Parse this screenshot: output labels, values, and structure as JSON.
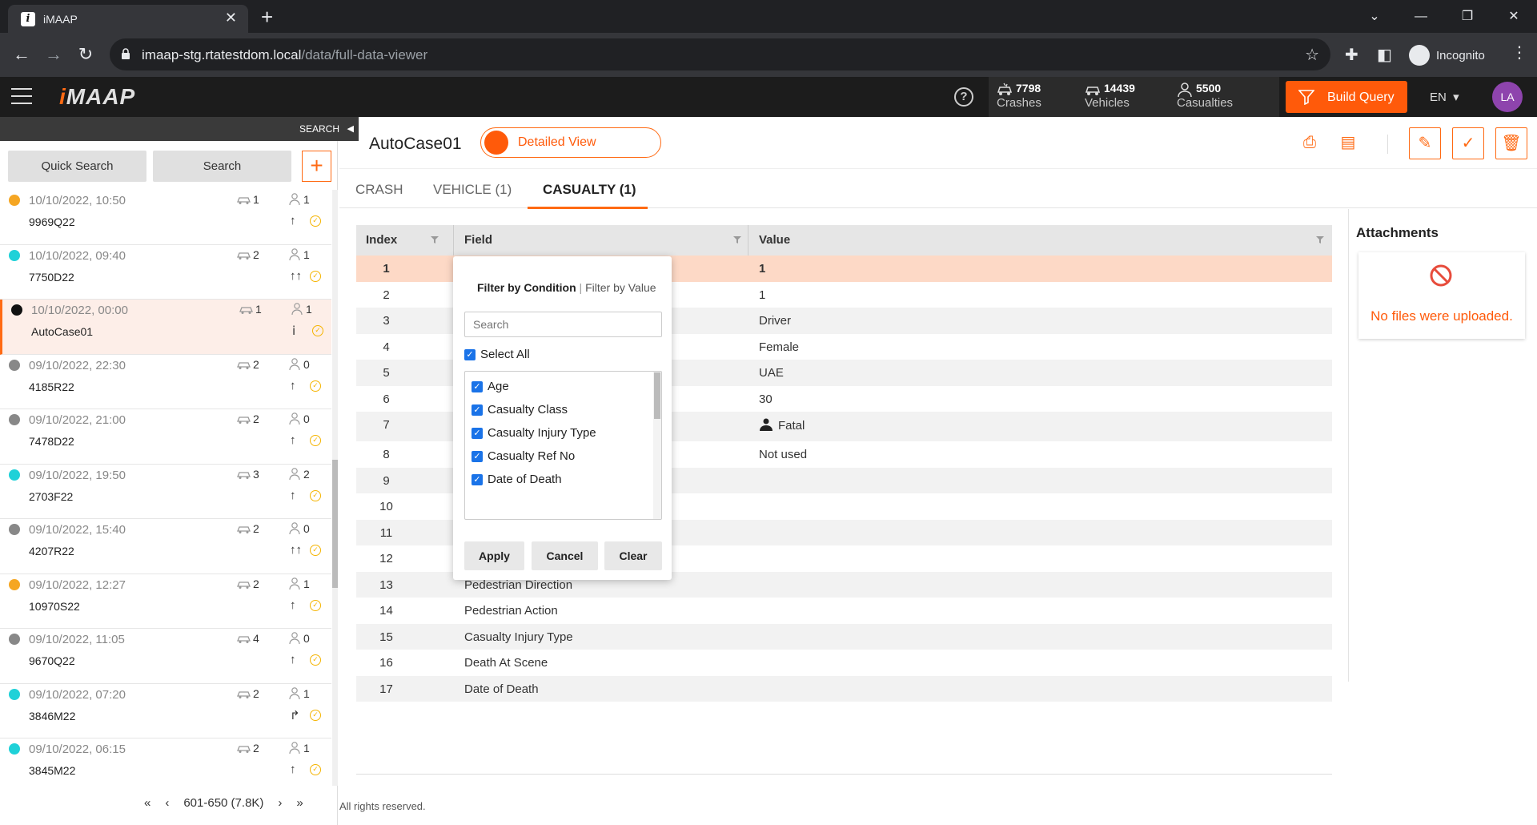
{
  "browser": {
    "tab_title": "iMAAP",
    "url_host": "imaap-stg.rtatestdom.local",
    "url_path": "/data/full-data-viewer",
    "profile": "Incognito"
  },
  "app": {
    "logo_prefix": "i",
    "logo_rest": "MAAP",
    "stats": {
      "crashes": {
        "value": "7798",
        "label": "Crashes"
      },
      "vehicles": {
        "value": "14439",
        "label": "Vehicles"
      },
      "casualties": {
        "value": "5500",
        "label": "Casualties"
      }
    },
    "build_query": "Build Query",
    "language": "EN",
    "avatar": "LA",
    "accent_color": "#ff5a0a"
  },
  "sidebar": {
    "strip_label": "SEARCH",
    "quick_search": "Quick Search",
    "search": "Search",
    "plus": "+",
    "cases": [
      {
        "datetime": "10/10/2022, 10:50",
        "ref": "9969Q22",
        "vehicles": "1",
        "casualties": "1",
        "dot": "#f5a623",
        "move": "↑"
      },
      {
        "datetime": "10/10/2022, 09:40",
        "ref": "7750D22",
        "vehicles": "2",
        "casualties": "1",
        "dot": "#1fd1d8",
        "move": "↑↑"
      },
      {
        "datetime": "10/10/2022, 00:00",
        "ref": "AutoCase01",
        "vehicles": "1",
        "casualties": "1",
        "dot": "#111111",
        "move": "ⅰ"
      },
      {
        "datetime": "09/10/2022, 22:30",
        "ref": "4185R22",
        "vehicles": "2",
        "casualties": "0",
        "dot": "#888888",
        "move": "↑"
      },
      {
        "datetime": "09/10/2022, 21:00",
        "ref": "7478D22",
        "vehicles": "2",
        "casualties": "0",
        "dot": "#888888",
        "move": "↑"
      },
      {
        "datetime": "09/10/2022, 19:50",
        "ref": "2703F22",
        "vehicles": "3",
        "casualties": "2",
        "dot": "#1fd1d8",
        "move": "↑"
      },
      {
        "datetime": "09/10/2022, 15:40",
        "ref": "4207R22",
        "vehicles": "2",
        "casualties": "0",
        "dot": "#888888",
        "move": "↑↑"
      },
      {
        "datetime": "09/10/2022, 12:27",
        "ref": "10970S22",
        "vehicles": "2",
        "casualties": "1",
        "dot": "#f5a623",
        "move": "↑"
      },
      {
        "datetime": "09/10/2022, 11:05",
        "ref": "9670Q22",
        "vehicles": "4",
        "casualties": "0",
        "dot": "#888888",
        "move": "↑"
      },
      {
        "datetime": "09/10/2022, 07:20",
        "ref": "3846M22",
        "vehicles": "2",
        "casualties": "1",
        "dot": "#1fd1d8",
        "move": "↱"
      },
      {
        "datetime": "09/10/2022, 06:15",
        "ref": "3845M22",
        "vehicles": "2",
        "casualties": "1",
        "dot": "#1fd1d8",
        "move": "↑"
      }
    ],
    "pager": "601-650 (7.8K)"
  },
  "main": {
    "case_title": "AutoCase01",
    "view_toggle": "Detailed View",
    "tabs": [
      "CRASH",
      "VEHICLE (1)",
      "CASUALTY (1)"
    ],
    "grid_headers": {
      "index": "Index",
      "field": "Field",
      "value": "Value"
    },
    "rows": [
      {
        "index": "1",
        "field": "",
        "value": "1"
      },
      {
        "index": "2",
        "field": "",
        "value": "1"
      },
      {
        "index": "3",
        "field": "",
        "value": "Driver"
      },
      {
        "index": "4",
        "field": "",
        "value": "Female"
      },
      {
        "index": "5",
        "field": "",
        "value": "UAE"
      },
      {
        "index": "6",
        "field": "",
        "value": "30"
      },
      {
        "index": "7",
        "field": "",
        "value": "Fatal"
      },
      {
        "index": "8",
        "field": "",
        "value": "Not used"
      },
      {
        "index": "9",
        "field": "",
        "value": ""
      },
      {
        "index": "10",
        "field": "",
        "value": ""
      },
      {
        "index": "11",
        "field": "",
        "value": ""
      },
      {
        "index": "12",
        "field": "",
        "value": ""
      },
      {
        "index": "13",
        "field": "Pedestrian Direction",
        "value": ""
      },
      {
        "index": "14",
        "field": "Pedestrian Action",
        "value": ""
      },
      {
        "index": "15",
        "field": "Casualty Injury Type",
        "value": ""
      },
      {
        "index": "16",
        "field": "Death At Scene",
        "value": ""
      },
      {
        "index": "17",
        "field": "Date of Death",
        "value": ""
      }
    ],
    "copyright": "All rights reserved."
  },
  "attachments": {
    "title": "Attachments",
    "empty_message": "No files were uploaded."
  },
  "filter": {
    "by_condition": "Filter by Condition",
    "separator": " | ",
    "by_value": "Filter by Value",
    "search_placeholder": "Search",
    "select_all": "Select All",
    "items": [
      "Age",
      "Casualty Class",
      "Casualty Injury Type",
      "Casualty Ref No",
      "Date of Death"
    ],
    "apply": "Apply",
    "cancel": "Cancel",
    "clear": "Clear"
  }
}
